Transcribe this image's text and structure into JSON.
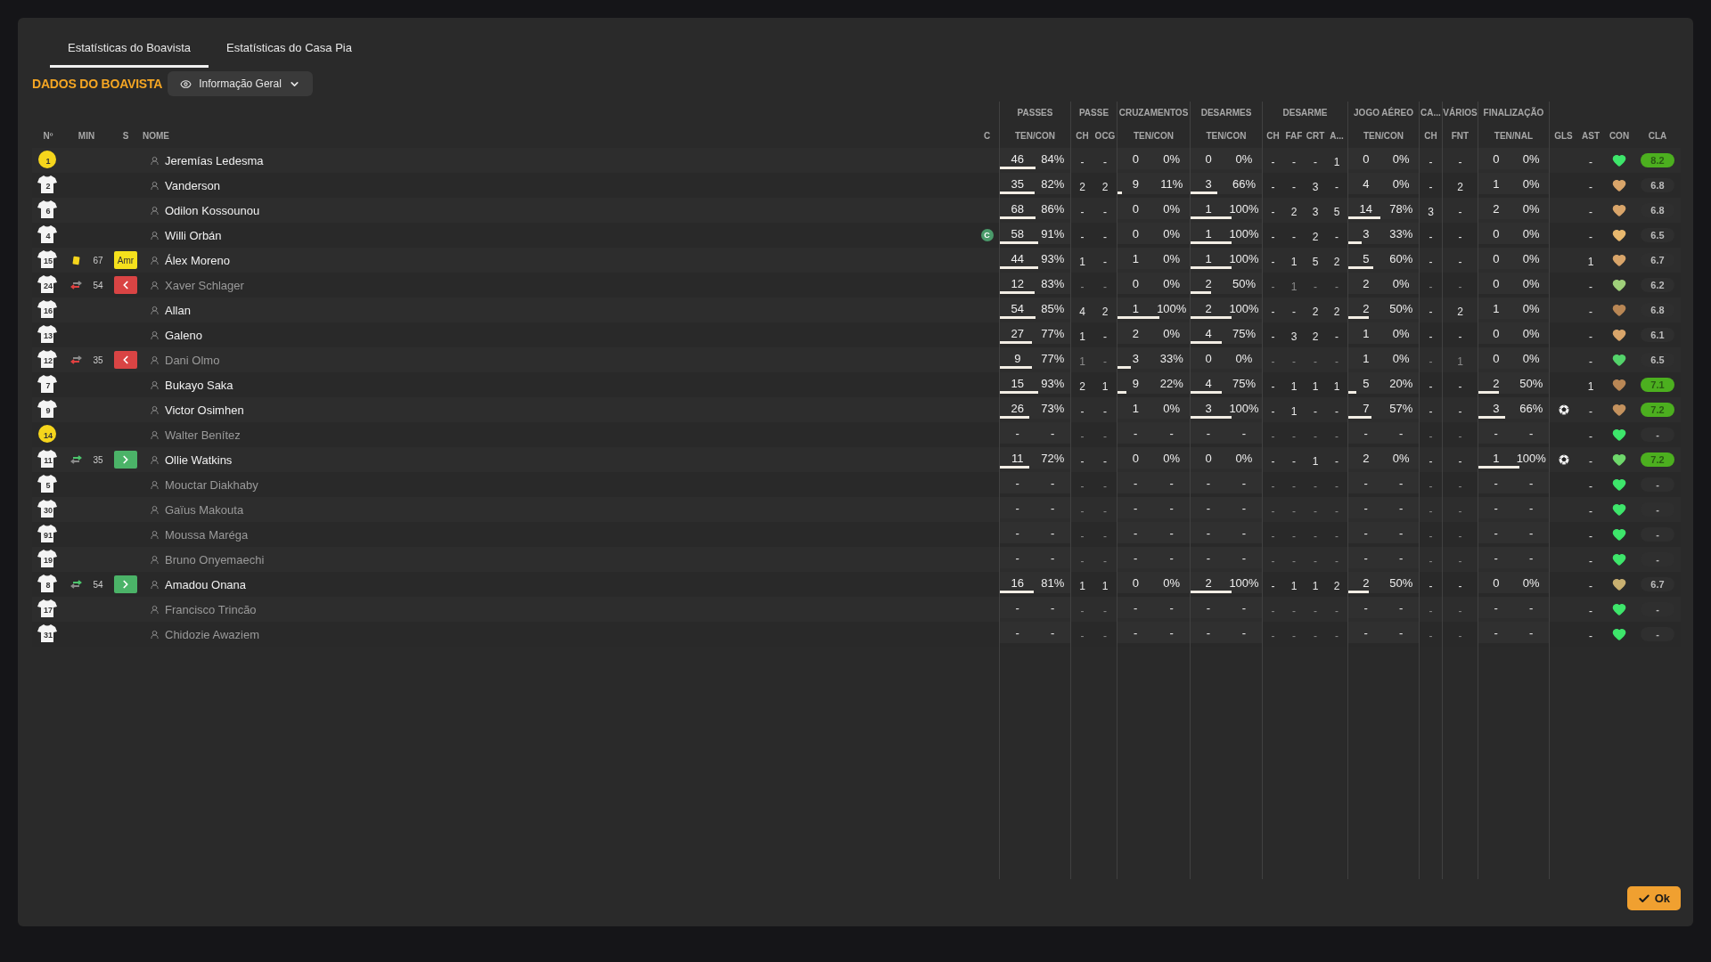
{
  "tabs": [
    {
      "label": "Estatísticas do Boavista",
      "selected": true
    },
    {
      "label": "Estatísticas do Casa Pia",
      "selected": false
    }
  ],
  "section_title": "DADOS DO BOAVISTA",
  "view_dropdown": {
    "value": "Informação Geral"
  },
  "table": {
    "left_columns": [
      "Nº",
      "MIN",
      "S",
      "NOME",
      "C"
    ],
    "column_groups": [
      {
        "label": "PASSES",
        "columns": [
          "TEN/CON"
        ]
      },
      {
        "label": "PASSE",
        "columns": [
          "CH",
          "OCG"
        ]
      },
      {
        "label": "CRUZAMENTOS",
        "columns": [
          "TEN/CON"
        ]
      },
      {
        "label": "DESARMES",
        "columns": [
          "TEN/CON"
        ]
      },
      {
        "label": "DESARME",
        "columns": [
          "CH",
          "FAF",
          "CRT",
          "A..."
        ]
      },
      {
        "label": "JOGO AÉREO",
        "columns": [
          "TEN/CON"
        ]
      },
      {
        "label": "CA...",
        "columns": [
          "CH"
        ]
      },
      {
        "label": "VÁRIOS",
        "columns": [
          "FNT"
        ]
      },
      {
        "label": "FINALIZAÇÃO",
        "columns": [
          "TEN/NAL"
        ]
      }
    ],
    "extra_columns": [
      "GLS",
      "AST",
      "CON",
      "CLA"
    ],
    "captain_badge": "C",
    "rows": [
      {
        "number": "1",
        "kind": "goalkeeper",
        "name": "Jeremías Ledesma",
        "dimmed": false,
        "captain": false,
        "stats": [
          {
            "tries": "46",
            "rate": "84%",
            "level": 0.5
          },
          "-",
          "-",
          {
            "tries": "0",
            "rate": "0%"
          },
          {
            "tries": "0",
            "rate": "0%"
          },
          "-",
          "-",
          "-",
          "1",
          {
            "tries": "0",
            "rate": "0%"
          },
          "-",
          "-",
          {
            "tries": "0",
            "rate": "0%"
          }
        ],
        "goal": false,
        "assists": "-",
        "color": "#3ee66b",
        "rating": "8.2",
        "rating_highlight": true
      },
      {
        "number": "2",
        "kind": "outfield",
        "name": "Vanderson",
        "dimmed": false,
        "captain": false,
        "stats": [
          {
            "tries": "35",
            "rate": "82%",
            "level": 0.49
          },
          "2",
          "2",
          {
            "tries": "9",
            "rate": "11%",
            "level": 0.06
          },
          {
            "tries": "3",
            "rate": "66%",
            "level": 0.38
          },
          "-",
          "-",
          "3",
          "-",
          {
            "tries": "4",
            "rate": "0%"
          },
          "-",
          "2",
          {
            "tries": "1",
            "rate": "0%"
          }
        ],
        "goal": false,
        "assists": "-",
        "color": "#d9a56a",
        "rating": "6.8",
        "rating_highlight": false
      },
      {
        "number": "6",
        "kind": "outfield",
        "name": "Odilon Kossounou",
        "dimmed": false,
        "captain": false,
        "stats": [
          {
            "tries": "68",
            "rate": "86%",
            "level": 0.51
          },
          "-",
          "-",
          {
            "tries": "0",
            "rate": "0%"
          },
          {
            "tries": "1",
            "rate": "100%",
            "level": 0.58
          },
          "-",
          "2",
          "3",
          "5",
          {
            "tries": "14",
            "rate": "78%",
            "level": 0.45
          },
          "3",
          "-",
          {
            "tries": "2",
            "rate": "0%"
          }
        ],
        "goal": false,
        "assists": "-",
        "color": "#d9a56a",
        "rating": "6.8",
        "rating_highlight": false
      },
      {
        "number": "4",
        "kind": "outfield",
        "name": "Willi Orbán",
        "dimmed": false,
        "captain": true,
        "stats": [
          {
            "tries": "58",
            "rate": "91%",
            "level": 0.54
          },
          "-",
          "-",
          {
            "tries": "0",
            "rate": "0%"
          },
          {
            "tries": "1",
            "rate": "100%",
            "level": 0.58
          },
          "-",
          "-",
          "2",
          "-",
          {
            "tries": "3",
            "rate": "33%",
            "level": 0.19
          },
          "-",
          "-",
          {
            "tries": "0",
            "rate": "0%"
          }
        ],
        "goal": false,
        "assists": "-",
        "color": "#e8b86e",
        "rating": "6.5",
        "rating_highlight": false
      },
      {
        "number": "15",
        "kind": "outfield",
        "name": "Álex Moreno",
        "dimmed": false,
        "captain": false,
        "event": {
          "kind": "yellow_card",
          "minute": "67",
          "badge": "Amr"
        },
        "stats": [
          {
            "tries": "44",
            "rate": "93%",
            "level": 0.55
          },
          "1",
          "-",
          {
            "tries": "1",
            "rate": "0%"
          },
          {
            "tries": "1",
            "rate": "100%",
            "level": 0.58
          },
          "-",
          "1",
          "5",
          "2",
          {
            "tries": "5",
            "rate": "60%",
            "level": 0.35
          },
          "-",
          "-",
          {
            "tries": "0",
            "rate": "0%"
          }
        ],
        "goal": false,
        "assists": "1",
        "color": "#d9a56a",
        "rating": "6.7",
        "rating_highlight": false
      },
      {
        "number": "24",
        "kind": "outfield",
        "name": "Xaver Schlager",
        "dimmed": true,
        "captain": false,
        "event": {
          "kind": "sub_off",
          "minute": "54"
        },
        "stats": [
          {
            "tries": "12",
            "rate": "83%",
            "level": 0.49
          },
          "-",
          "-",
          {
            "tries": "0",
            "rate": "0%"
          },
          {
            "tries": "2",
            "rate": "50%",
            "level": 0.29
          },
          "-",
          "1",
          "-",
          "-",
          {
            "tries": "2",
            "rate": "0%"
          },
          "-",
          "-",
          {
            "tries": "0",
            "rate": "0%"
          }
        ],
        "goal": false,
        "assists": "-",
        "color": "#9fcf7a",
        "rating": "6.2",
        "rating_highlight": false
      },
      {
        "number": "16",
        "kind": "outfield",
        "name": "Allan",
        "dimmed": false,
        "captain": false,
        "stats": [
          {
            "tries": "54",
            "rate": "85%",
            "level": 0.5
          },
          "4",
          "2",
          {
            "tries": "1",
            "rate": "100%",
            "level": 0.58
          },
          {
            "tries": "2",
            "rate": "100%",
            "level": 0.58
          },
          "-",
          "-",
          "2",
          "2",
          {
            "tries": "2",
            "rate": "50%",
            "level": 0.29
          },
          "-",
          "2",
          {
            "tries": "1",
            "rate": "0%"
          }
        ],
        "goal": false,
        "assists": "-",
        "color": "#b98755",
        "rating": "6.8",
        "rating_highlight": false
      },
      {
        "number": "13",
        "kind": "outfield",
        "name": "Galeno",
        "dimmed": false,
        "captain": false,
        "stats": [
          {
            "tries": "27",
            "rate": "77%",
            "level": 0.46
          },
          "1",
          "-",
          {
            "tries": "2",
            "rate": "0%"
          },
          {
            "tries": "4",
            "rate": "75%",
            "level": 0.44
          },
          "-",
          "3",
          "2",
          "-",
          {
            "tries": "1",
            "rate": "0%"
          },
          "-",
          "-",
          {
            "tries": "0",
            "rate": "0%"
          }
        ],
        "goal": false,
        "assists": "-",
        "color": "#d9a56a",
        "rating": "6.1",
        "rating_highlight": false
      },
      {
        "number": "12",
        "kind": "outfield",
        "name": "Dani Olmo",
        "dimmed": true,
        "captain": false,
        "event": {
          "kind": "sub_off",
          "minute": "35"
        },
        "stats": [
          {
            "tries": "9",
            "rate": "77%",
            "level": 0.46
          },
          "1",
          "-",
          {
            "tries": "3",
            "rate": "33%",
            "level": 0.19
          },
          {
            "tries": "0",
            "rate": "0%"
          },
          "-",
          "-",
          "-",
          "-",
          {
            "tries": "1",
            "rate": "0%"
          },
          "-",
          "1",
          {
            "tries": "0",
            "rate": "0%"
          }
        ],
        "goal": false,
        "assists": "-",
        "color": "#54d36b",
        "rating": "6.5",
        "rating_highlight": false
      },
      {
        "number": "7",
        "kind": "outfield",
        "name": "Bukayo Saka",
        "dimmed": false,
        "captain": false,
        "stats": [
          {
            "tries": "15",
            "rate": "93%",
            "level": 0.55
          },
          "2",
          "1",
          {
            "tries": "9",
            "rate": "22%",
            "level": 0.12
          },
          {
            "tries": "4",
            "rate": "75%",
            "level": 0.44
          },
          "-",
          "1",
          "1",
          "1",
          {
            "tries": "5",
            "rate": "20%",
            "level": 0.12
          },
          "-",
          "-",
          {
            "tries": "2",
            "rate": "50%",
            "level": 0.29
          }
        ],
        "goal": false,
        "assists": "1",
        "color": "#b98755",
        "rating": "7.1",
        "rating_highlight": true
      },
      {
        "number": "9",
        "kind": "outfield",
        "name": "Victor Osimhen",
        "dimmed": false,
        "captain": false,
        "stats": [
          {
            "tries": "26",
            "rate": "73%",
            "level": 0.42
          },
          "-",
          "-",
          {
            "tries": "1",
            "rate": "0%"
          },
          {
            "tries": "3",
            "rate": "100%",
            "level": 0.58
          },
          "-",
          "1",
          "-",
          "-",
          {
            "tries": "7",
            "rate": "57%",
            "level": 0.33
          },
          "-",
          "-",
          {
            "tries": "3",
            "rate": "66%",
            "level": 0.38
          }
        ],
        "goal": true,
        "assists": "-",
        "color": "#c4925e",
        "rating": "7.2",
        "rating_highlight": true
      },
      {
        "number": "14",
        "kind": "goalkeeper",
        "name": "Walter Benítez",
        "dimmed": true,
        "captain": false,
        "stats": [
          {
            "tries": "-",
            "rate": "-"
          },
          "-",
          "-",
          {
            "tries": "-",
            "rate": "-"
          },
          {
            "tries": "-",
            "rate": "-"
          },
          "-",
          "-",
          "-",
          "-",
          {
            "tries": "-",
            "rate": "-"
          },
          "-",
          "-",
          {
            "tries": "-",
            "rate": "-"
          }
        ],
        "goal": false,
        "assists": "-",
        "color": "#3ee66b",
        "rating": "-",
        "rating_highlight": false
      },
      {
        "number": "11",
        "kind": "outfield",
        "name": "Ollie Watkins",
        "dimmed": false,
        "captain": false,
        "event": {
          "kind": "sub_on",
          "minute": "35"
        },
        "stats": [
          {
            "tries": "11",
            "rate": "72%",
            "level": 0.42
          },
          "-",
          "-",
          {
            "tries": "0",
            "rate": "0%"
          },
          {
            "tries": "0",
            "rate": "0%"
          },
          "-",
          "-",
          "1",
          "-",
          {
            "tries": "2",
            "rate": "0%"
          },
          "-",
          "-",
          {
            "tries": "1",
            "rate": "100%",
            "level": 0.58
          }
        ],
        "goal": true,
        "assists": "-",
        "color": "#6ed86b",
        "rating": "7.2",
        "rating_highlight": true
      },
      {
        "number": "5",
        "kind": "outfield",
        "name": "Mouctar Diakhaby",
        "dimmed": true,
        "captain": false,
        "stats": [
          {
            "tries": "-",
            "rate": "-"
          },
          "-",
          "-",
          {
            "tries": "-",
            "rate": "-"
          },
          {
            "tries": "-",
            "rate": "-"
          },
          "-",
          "-",
          "-",
          "-",
          {
            "tries": "-",
            "rate": "-"
          },
          "-",
          "-",
          {
            "tries": "-",
            "rate": "-"
          }
        ],
        "goal": false,
        "assists": "-",
        "color": "#3ee66b",
        "rating": "-",
        "rating_highlight": false
      },
      {
        "number": "30",
        "kind": "outfield",
        "name": "Gaïus Makouta",
        "dimmed": true,
        "captain": false,
        "stats": [
          {
            "tries": "-",
            "rate": "-"
          },
          "-",
          "-",
          {
            "tries": "-",
            "rate": "-"
          },
          {
            "tries": "-",
            "rate": "-"
          },
          "-",
          "-",
          "-",
          "-",
          {
            "tries": "-",
            "rate": "-"
          },
          "-",
          "-",
          {
            "tries": "-",
            "rate": "-"
          }
        ],
        "goal": false,
        "assists": "-",
        "color": "#3ee66b",
        "rating": "-",
        "rating_highlight": false
      },
      {
        "number": "91",
        "kind": "outfield",
        "name": "Moussa Maréga",
        "dimmed": true,
        "captain": false,
        "stats": [
          {
            "tries": "-",
            "rate": "-"
          },
          "-",
          "-",
          {
            "tries": "-",
            "rate": "-"
          },
          {
            "tries": "-",
            "rate": "-"
          },
          "-",
          "-",
          "-",
          "-",
          {
            "tries": "-",
            "rate": "-"
          },
          "-",
          "-",
          {
            "tries": "-",
            "rate": "-"
          }
        ],
        "goal": false,
        "assists": "-",
        "color": "#3ee66b",
        "rating": "-",
        "rating_highlight": false
      },
      {
        "number": "19",
        "kind": "outfield",
        "name": "Bruno Onyemaechi",
        "dimmed": true,
        "captain": false,
        "stats": [
          {
            "tries": "-",
            "rate": "-"
          },
          "-",
          "-",
          {
            "tries": "-",
            "rate": "-"
          },
          {
            "tries": "-",
            "rate": "-"
          },
          "-",
          "-",
          "-",
          "-",
          {
            "tries": "-",
            "rate": "-"
          },
          "-",
          "-",
          {
            "tries": "-",
            "rate": "-"
          }
        ],
        "goal": false,
        "assists": "-",
        "color": "#3ee66b",
        "rating": "-",
        "rating_highlight": false
      },
      {
        "number": "8",
        "kind": "outfield",
        "name": "Amadou Onana",
        "dimmed": false,
        "captain": false,
        "event": {
          "kind": "sub_on",
          "minute": "54"
        },
        "stats": [
          {
            "tries": "16",
            "rate": "81%",
            "level": 0.48
          },
          "1",
          "1",
          {
            "tries": "0",
            "rate": "0%"
          },
          {
            "tries": "2",
            "rate": "100%",
            "level": 0.58
          },
          "-",
          "1",
          "1",
          "2",
          {
            "tries": "2",
            "rate": "50%",
            "level": 0.29
          },
          "-",
          "-",
          {
            "tries": "0",
            "rate": "0%"
          }
        ],
        "goal": false,
        "assists": "-",
        "color": "#c9b070",
        "rating": "6.7",
        "rating_highlight": false
      },
      {
        "number": "17",
        "kind": "outfield",
        "name": "Francisco Trincão",
        "dimmed": true,
        "captain": false,
        "stats": [
          {
            "tries": "-",
            "rate": "-"
          },
          "-",
          "-",
          {
            "tries": "-",
            "rate": "-"
          },
          {
            "tries": "-",
            "rate": "-"
          },
          "-",
          "-",
          "-",
          "-",
          {
            "tries": "-",
            "rate": "-"
          },
          "-",
          "-",
          {
            "tries": "-",
            "rate": "-"
          }
        ],
        "goal": false,
        "assists": "-",
        "color": "#3ee66b",
        "rating": "-",
        "rating_highlight": false
      },
      {
        "number": "31",
        "kind": "outfield",
        "name": "Chidozie Awaziem",
        "dimmed": true,
        "captain": false,
        "stats": [
          {
            "tries": "-",
            "rate": "-"
          },
          "-",
          "-",
          {
            "tries": "-",
            "rate": "-"
          },
          {
            "tries": "-",
            "rate": "-"
          },
          "-",
          "-",
          "-",
          "-",
          {
            "tries": "-",
            "rate": "-"
          },
          "-",
          "-",
          {
            "tries": "-",
            "rate": "-"
          }
        ],
        "goal": false,
        "assists": "-",
        "color": "#3ee66b",
        "rating": "-",
        "rating_highlight": false
      }
    ]
  },
  "ok_button": "Ok"
}
